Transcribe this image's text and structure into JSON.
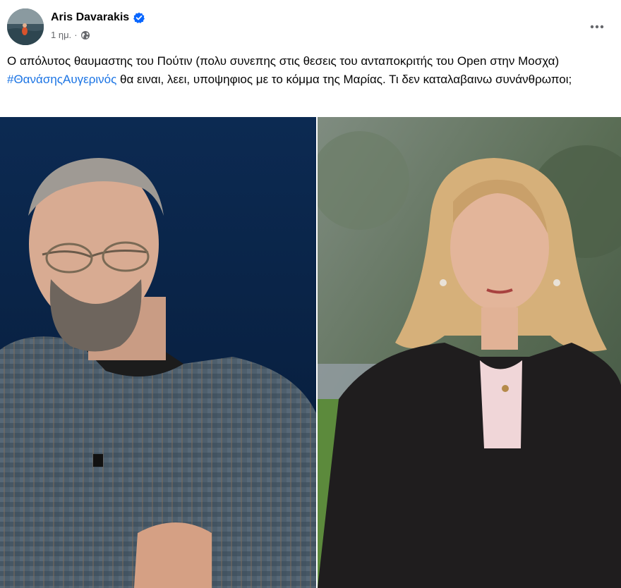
{
  "post": {
    "author": "Aris Davarakis",
    "timestamp": "1 ημ.",
    "separator": "·",
    "text_before": "Ο απόλυτος θαυμαστης του Πούτιν (πολυ συνεπης στις θεσεις του ανταποκριτής του Open στην Μοσχα) ",
    "hashtag": "#ΘανάσηςΑυγερινός",
    "text_after": " θα ειναι, λεει, υποψηφιος με το κόμμα της Μαρίας. Τι δεν καταλαβαινω συνάνθρωποι;"
  },
  "icons": {
    "verified": "verified-badge-icon",
    "audience": "globe-icon",
    "more": "more-horizontal-icon"
  },
  "colors": {
    "link": "#1b74e4",
    "verified": "#0866ff",
    "secondary_text": "#65676b"
  }
}
